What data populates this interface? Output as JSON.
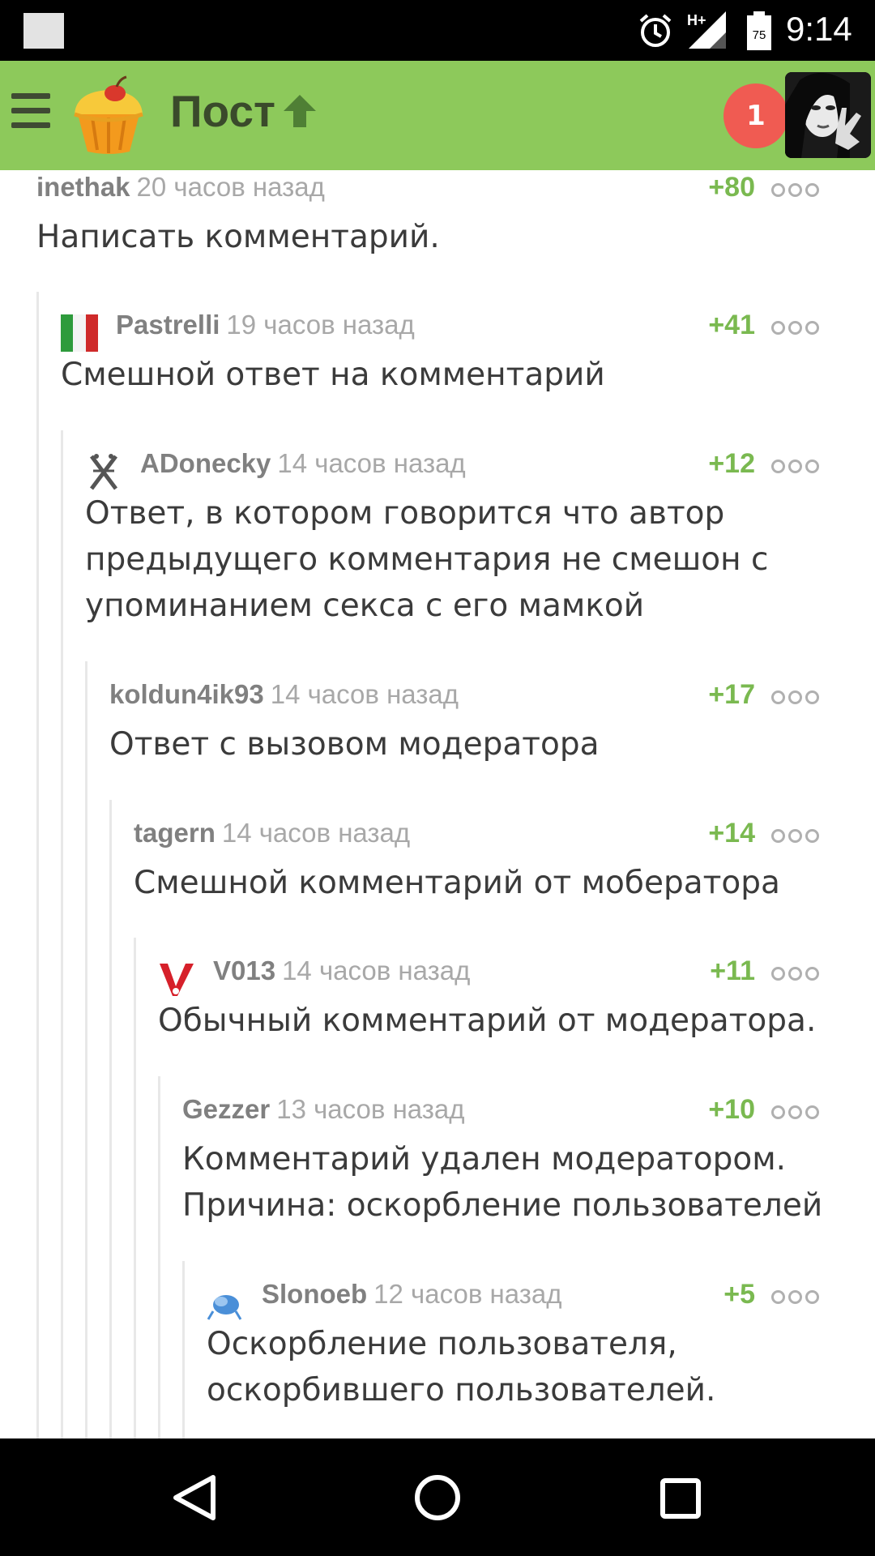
{
  "status_bar": {
    "time": "9:14",
    "network": "H+",
    "battery": "75",
    "icons": [
      "notification-square-icon",
      "alarm-icon",
      "signal-icon",
      "battery-icon"
    ]
  },
  "header": {
    "title": "Пост",
    "notification_count": "1",
    "icons": [
      "menu-icon",
      "cupcake-logo-icon",
      "arrow-up-icon",
      "avatar"
    ]
  },
  "colors": {
    "app_bar": "#8dc95b",
    "score": "#7ab950",
    "badge": "#f05b52",
    "username": "#808080",
    "time": "#a8a8a8"
  },
  "comments": [
    {
      "user": "inethak",
      "time": "20 часов назад",
      "score": "+80",
      "text": [
        "Написать комментарий."
      ],
      "avatar": "none"
    },
    {
      "user": "Pastrelli",
      "time": "19 часов назад",
      "score": "+41",
      "text": [
        "Смешной ответ на комментарий"
      ],
      "avatar": "italy-flag-icon"
    },
    {
      "user": "ADonecky",
      "time": "14 часов назад",
      "score": "+12",
      "text": [
        "Ответ, в котором говорится что автор",
        "предыдущего комментария не смешон с",
        "упоминанием секса с его мамкой"
      ],
      "avatar": "x-symbol-icon"
    },
    {
      "user": "koldun4ik93",
      "time": "14 часов назад",
      "score": "+17",
      "text": [
        "Ответ с вызовом модератора"
      ],
      "avatar": "none"
    },
    {
      "user": "tagern",
      "time": "14 часов назад",
      "score": "+14",
      "text": [
        "Смешной комментарий от мобератора"
      ],
      "avatar": "none"
    },
    {
      "user": "V013",
      "time": "14 часов назад",
      "score": "+11",
      "text": [
        "Обычный комментарий от модератора."
      ],
      "avatar": "v-logo-icon"
    },
    {
      "user": "Gezzer",
      "time": "13 часов назад",
      "score": "+10",
      "text": [
        "Комментарий удален модератором.",
        "Причина: оскорбление пользователей"
      ],
      "avatar": "none"
    },
    {
      "user": "Slonoeb",
      "time": "12 часов назад",
      "score": "+5",
      "text": [
        "Оскорбление пользователя,",
        "оскорбившего пользователей."
      ],
      "avatar": "blue-bird-icon"
    }
  ],
  "nav_bar": {
    "buttons": [
      "back-icon",
      "home-icon",
      "recents-icon"
    ]
  }
}
